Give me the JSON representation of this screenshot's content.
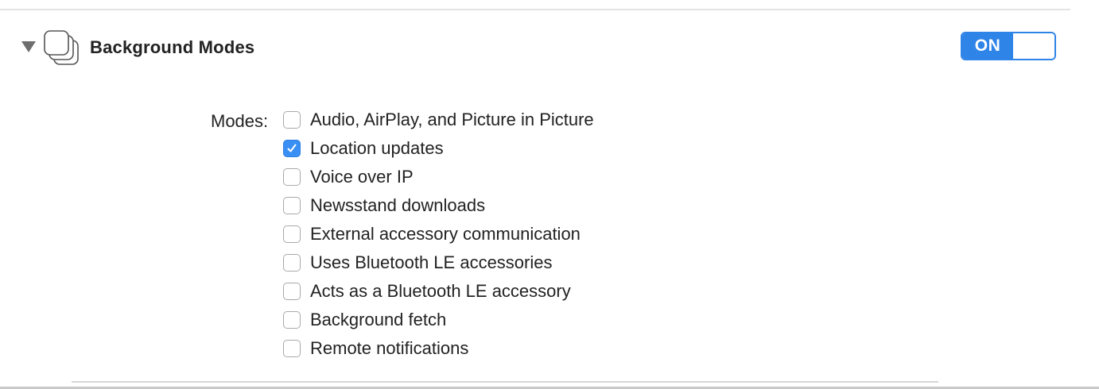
{
  "section": {
    "title": "Background Modes",
    "expanded": true,
    "icon": "stacked-screens-icon"
  },
  "toggle": {
    "label": "ON",
    "state": true,
    "accent_color": "#2f84e8"
  },
  "modes": {
    "label": "Modes:",
    "items": [
      {
        "label": "Audio, AirPlay, and Picture in Picture",
        "checked": false
      },
      {
        "label": "Location updates",
        "checked": true
      },
      {
        "label": "Voice over IP",
        "checked": false
      },
      {
        "label": "Newsstand downloads",
        "checked": false
      },
      {
        "label": "External accessory communication",
        "checked": false
      },
      {
        "label": "Uses Bluetooth LE accessories",
        "checked": false
      },
      {
        "label": "Acts as a Bluetooth LE accessory",
        "checked": false
      },
      {
        "label": "Background fetch",
        "checked": false
      },
      {
        "label": "Remote notifications",
        "checked": false
      }
    ]
  }
}
